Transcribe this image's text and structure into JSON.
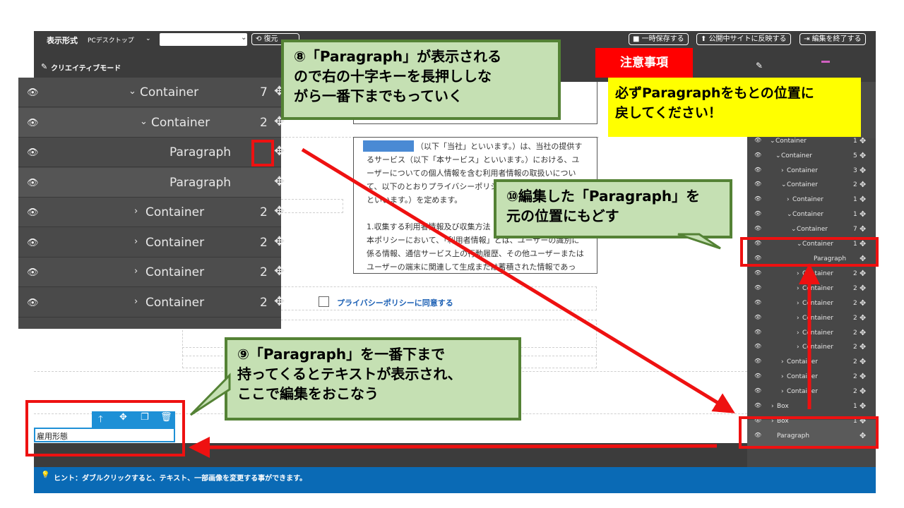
{
  "toolbar": {
    "display_label": "表示形式",
    "device_value": "PCデスクトップ",
    "restore_label": "復元",
    "save_temp_label": "一時保存する",
    "publish_label": "公開中サイトに反映する",
    "finish_label": "編集を終了する"
  },
  "mode": {
    "label": "クリエイティブモード"
  },
  "left_tree": [
    {
      "label": "Container",
      "count": "7",
      "chevron": "⌄"
    },
    {
      "label": "Container",
      "count": "2",
      "chevron": "⌄"
    },
    {
      "label": "Paragraph",
      "count": "",
      "chevron": ""
    },
    {
      "label": "Paragraph",
      "count": "",
      "chevron": ""
    },
    {
      "label": "Container",
      "count": "2",
      "chevron": "›"
    },
    {
      "label": "Container",
      "count": "2",
      "chevron": "›"
    },
    {
      "label": "Container",
      "count": "2",
      "chevron": "›"
    },
    {
      "label": "Container",
      "count": "2",
      "chevron": "›"
    }
  ],
  "right_tree": [
    {
      "label": "Container",
      "count": "1",
      "chevron": "⌄"
    },
    {
      "label": "Container",
      "count": "5",
      "chevron": "⌄"
    },
    {
      "label": "Container",
      "count": "3",
      "chevron": "›"
    },
    {
      "label": "Container",
      "count": "2",
      "chevron": "⌄"
    },
    {
      "label": "Container",
      "count": "1",
      "chevron": "›"
    },
    {
      "label": "Container",
      "count": "1",
      "chevron": "⌄"
    },
    {
      "label": "Container",
      "count": "7",
      "chevron": "⌄"
    },
    {
      "label": "Container",
      "count": "1",
      "chevron": "⌄"
    },
    {
      "label": "Paragraph",
      "count": "",
      "chevron": ""
    },
    {
      "label": "Container",
      "count": "2",
      "chevron": "›"
    },
    {
      "label": "Container",
      "count": "2",
      "chevron": "›"
    },
    {
      "label": "Container",
      "count": "2",
      "chevron": "›"
    },
    {
      "label": "Container",
      "count": "2",
      "chevron": "›"
    },
    {
      "label": "Container",
      "count": "2",
      "chevron": "›"
    },
    {
      "label": "Container",
      "count": "2",
      "chevron": "›"
    },
    {
      "label": "Container",
      "count": "2",
      "chevron": "›"
    },
    {
      "label": "Container",
      "count": "2",
      "chevron": "›"
    },
    {
      "label": "Container",
      "count": "2",
      "chevron": "›"
    },
    {
      "label": "Box",
      "count": "1",
      "chevron": "›"
    },
    {
      "label": "Box",
      "count": "1",
      "chevron": "›"
    },
    {
      "label": "Paragraph",
      "count": "",
      "chevron": ""
    }
  ],
  "document": {
    "lines": [
      "（以下「当社」といいます。）は、当社の提供す",
      "るサービス（以下「本サービス」といいます。）における、ユ",
      "ーザーについての個人情報を含む利用者情報の取扱いについ",
      "て、以下のとおりプライバシーポリシー（以下「本ポリシー」",
      "といいます。）を定めます。",
      "",
      "1.収集する利用者情報及び収集方法",
      "本ポリシーにおいて、「利用者情報」とは、ユーザーの識別に",
      "係る情報、通信サービス上の行動履歴、その他ユーザーまたは",
      "ユーザーの端末に関連して生成または蓄積された情報であっ"
    ],
    "checkbox_label": "プライバシーポリシーに同意する"
  },
  "selected_block": {
    "text": "雇用形態"
  },
  "hint": {
    "text": "ヒント：ダブルクリックすると、テキスト、一部画像を変更する事ができます。"
  },
  "annotations": {
    "notice_title": "注意事項",
    "notice_body": "必ずParagraphをもとの位置に\n戻してください！",
    "step8": "⑧「Paragraph」が表示される\nので右の十字キーを長押ししな\nがら一番下までもっていく",
    "step9": "⑨「Paragraph」を一番下まで\n持ってくるとテキストが表示され、\nここで編集をおこなう",
    "step10": "⑩編集した「Paragraph」を\n元の位置にもどす"
  },
  "colors": {
    "callout_bg": "#c5e0b3",
    "callout_border": "#548235",
    "red": "#ee1111",
    "notice_bg": "#ffff00",
    "hint_bg": "#0a6ab5"
  }
}
